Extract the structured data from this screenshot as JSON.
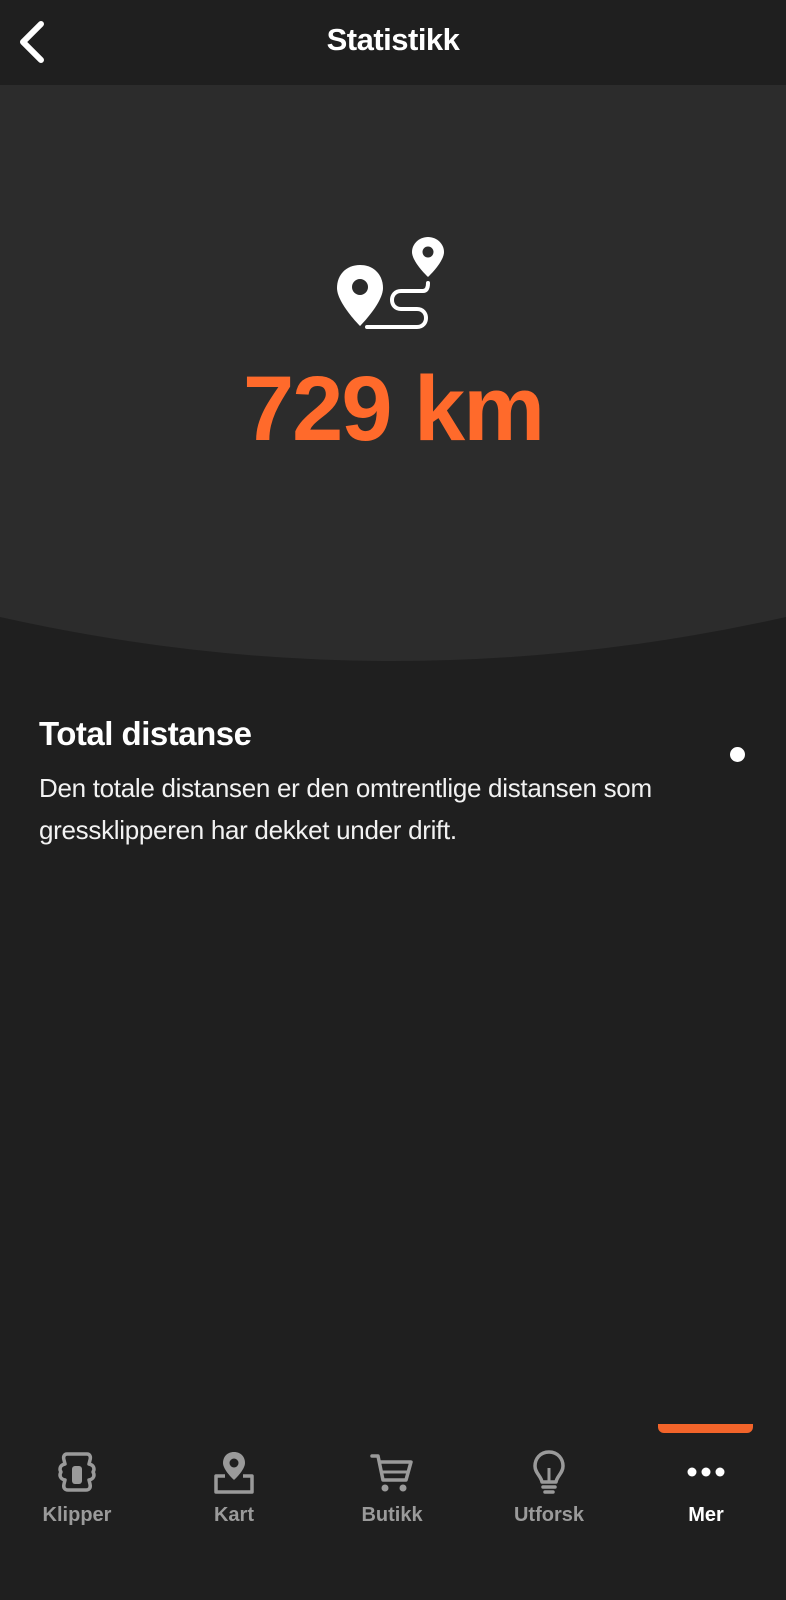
{
  "header": {
    "title": "Statistikk",
    "back_icon": "chevron-left-icon"
  },
  "hero": {
    "icon": "route-pins-icon",
    "value": "729 km",
    "accent_color": "#ff6a2b"
  },
  "info": {
    "title": "Total distanse",
    "description": "Den totale distansen er den omtrentlige distansen som gressklipperen har dekket under drift."
  },
  "tabbar": {
    "active_color": "#f2642a",
    "items": [
      {
        "label": "Klipper",
        "icon": "mower-icon",
        "active": false
      },
      {
        "label": "Kart",
        "icon": "map-pin-icon",
        "active": false
      },
      {
        "label": "Butikk",
        "icon": "cart-icon",
        "active": false
      },
      {
        "label": "Utforsk",
        "icon": "lightbulb-icon",
        "active": false
      },
      {
        "label": "Mer",
        "icon": "more-dots-icon",
        "active": true
      }
    ]
  }
}
